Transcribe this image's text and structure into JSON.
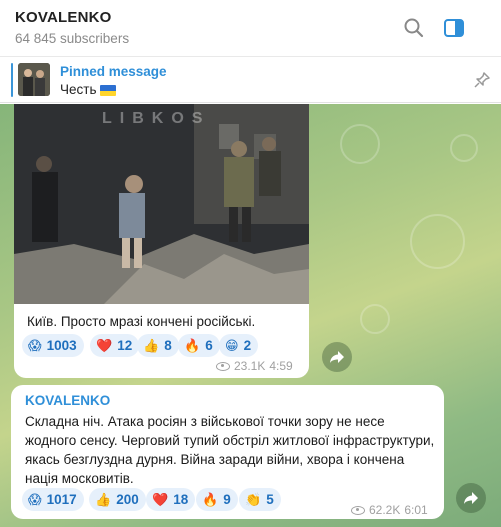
{
  "header": {
    "channel_name": "KOVALENKO",
    "subscribers": "64 845 subscribers"
  },
  "pinned": {
    "label": "Pinned message",
    "text": "Честь"
  },
  "photo": {
    "watermark": "LIBKOS"
  },
  "messages": [
    {
      "text": "Київ. Просто мразі кончені російські.",
      "reactions": [
        {
          "emoji": "😱",
          "count": "1003"
        },
        {
          "emoji": "❤️",
          "count": "12"
        },
        {
          "emoji": "👍",
          "count": "8"
        },
        {
          "emoji": "🔥",
          "count": "6"
        },
        {
          "emoji": "😁",
          "count": "2"
        }
      ],
      "views": "23.1K",
      "time": "4:59"
    },
    {
      "author": "KOVALENKO",
      "text": "Складна ніч. Атака росіян з військової точки зору не несе жодного сенсу. Черговий тупий обстріл житлової інфраструктури, якась безглуздна дурня. Війна заради війни, хвора і кончена нація московитів.",
      "reactions": [
        {
          "emoji": "😱",
          "count": "1017"
        },
        {
          "emoji": "👍",
          "count": "200"
        },
        {
          "emoji": "❤️",
          "count": "18"
        },
        {
          "emoji": "🔥",
          "count": "9"
        },
        {
          "emoji": "👏",
          "count": "5"
        }
      ],
      "views": "62.2K",
      "time": "6:01"
    }
  ],
  "colors": {
    "accent": "#2f8fd8",
    "reaction_bg": "#e6f0fb",
    "flag_blue": "#2c6fd1",
    "flag_yellow": "#ffd52b"
  },
  "icons": [
    "search-icon",
    "side-panel-icon",
    "pin-icon",
    "eye-icon",
    "share-icon"
  ]
}
